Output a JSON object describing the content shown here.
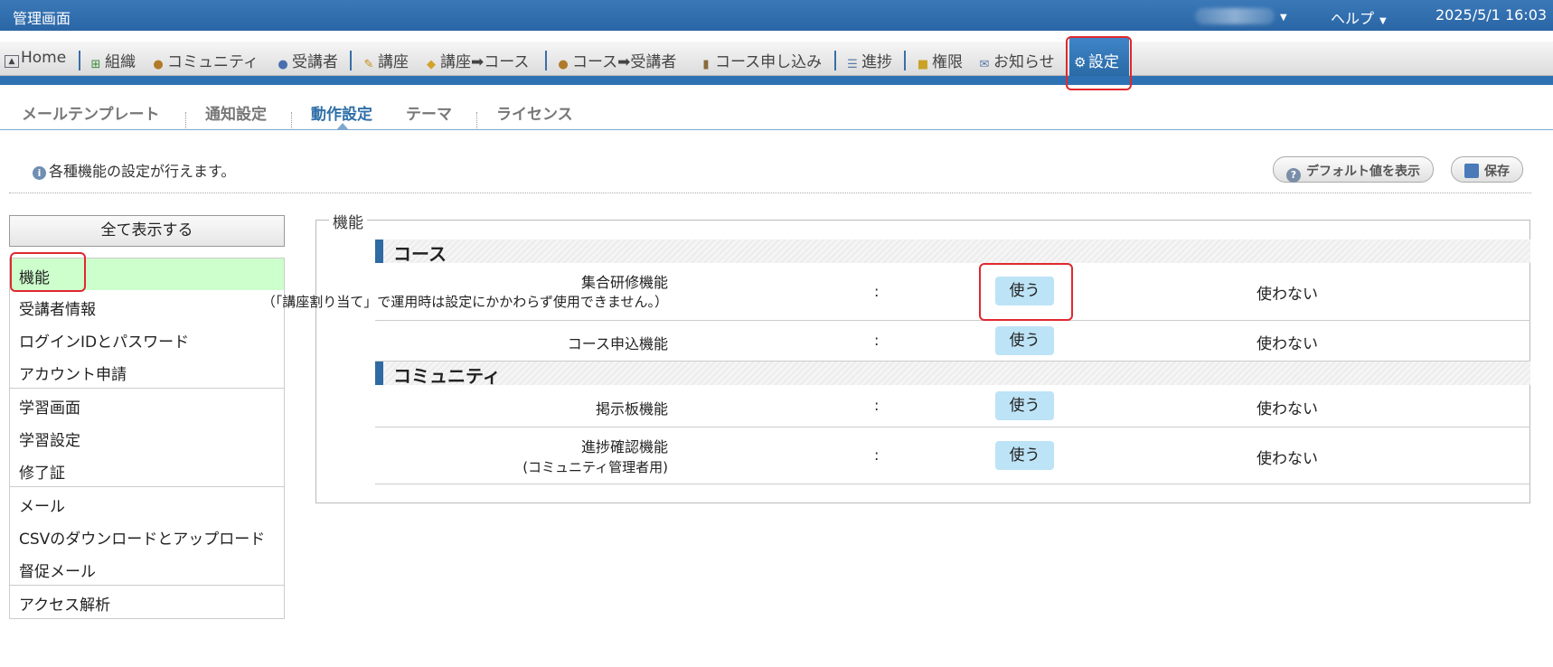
{
  "topbar": {
    "title": "管理画面",
    "help": "ヘルプ",
    "datetime": "2025/5/1 16:03"
  },
  "menu": {
    "items": [
      {
        "label": "Home",
        "icon": "image-icon"
      },
      {
        "label": "組織",
        "icon": "org-tree-icon"
      },
      {
        "label": "コミュニティ",
        "icon": "community-icon"
      },
      {
        "label": "受講者",
        "icon": "person-icon"
      },
      {
        "label": "講座",
        "icon": "pencil-icon"
      },
      {
        "label": "講座➡コース",
        "icon": "box-icon"
      },
      {
        "label": "コース➡受講者",
        "icon": "person-edit-icon"
      },
      {
        "label": "コース申し込み",
        "icon": "book-icon"
      },
      {
        "label": "進捗",
        "icon": "list-icon"
      },
      {
        "label": "権限",
        "icon": "lock-icon"
      },
      {
        "label": "お知らせ",
        "icon": "mail-icon"
      },
      {
        "label": "設定",
        "icon": "gear-icon"
      }
    ]
  },
  "tabs": [
    "メールテンプレート",
    "通知設定",
    "動作設定",
    "テーマ",
    "ライセンス"
  ],
  "info_text": "各種機能の設定が行えます。",
  "buttons": {
    "default": "デフォルト値を表示",
    "save": "保存"
  },
  "sidebar": {
    "show_all": "全て表示する",
    "items": [
      "機能",
      "受講者情報",
      "ログインIDとパスワード",
      "アカウント申請",
      "学習画面",
      "学習設定",
      "修了証",
      "メール",
      "CSVのダウンロードとアップロード",
      "督促メール",
      "アクセス解析"
    ]
  },
  "main": {
    "legend": "機能",
    "sections": [
      {
        "title": "コース",
        "rows": [
          {
            "label": "集合研修機能",
            "sub": "（「講座割り当て」で運用時は設定にかかわらず使用できません。）"
          },
          {
            "label": "コース申込機能"
          }
        ]
      },
      {
        "title": "コミュニティ",
        "rows": [
          {
            "label": "掲示板機能"
          },
          {
            "label": "進捗確認機能",
            "sub": "(コミュニティ管理者用)"
          }
        ]
      }
    ],
    "colon": ":",
    "use": "使う",
    "no_use": "使わない"
  },
  "colors": {
    "accent": "#2f72b3",
    "selected_category": "#ccffcc",
    "use_button": "#bde3f6",
    "highlight_box": "#e0282e"
  }
}
